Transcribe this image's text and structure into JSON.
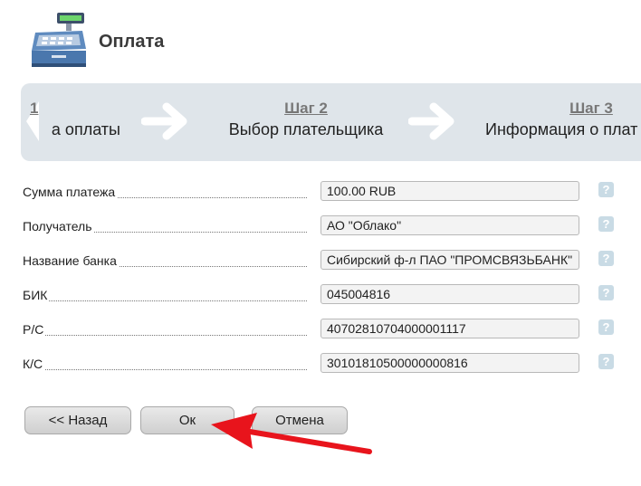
{
  "header": {
    "title": "Оплата",
    "icon": "cash-register-icon"
  },
  "steps": {
    "step1": {
      "name": "а оплаты",
      "num": "1"
    },
    "step2": {
      "num": "Шаг 2",
      "name": "Выбор плательщика"
    },
    "step3": {
      "num": "Шаг 3",
      "name": "Информация о плат"
    }
  },
  "form": {
    "rows": [
      {
        "label": "Сумма платежа",
        "value": "100.00 RUB"
      },
      {
        "label": "Получатель",
        "value": "АО \"Облако\""
      },
      {
        "label": "Название банка",
        "value": "Сибирский ф-л ПАО \"ПРОМСВЯЗЬБАНК\""
      },
      {
        "label": "БИК",
        "value": "045004816"
      },
      {
        "label": "Р/С",
        "value": "40702810704000001117"
      },
      {
        "label": "К/С",
        "value": "30101810500000000816"
      }
    ],
    "help_label": "?"
  },
  "buttons": {
    "back": "<< Назад",
    "ok": "Ок",
    "cancel": "Отмена"
  },
  "colors": {
    "steps_bg": "#dfe5ea",
    "annotation_arrow": "#e8141c",
    "help_bg": "#c9dbe5"
  }
}
